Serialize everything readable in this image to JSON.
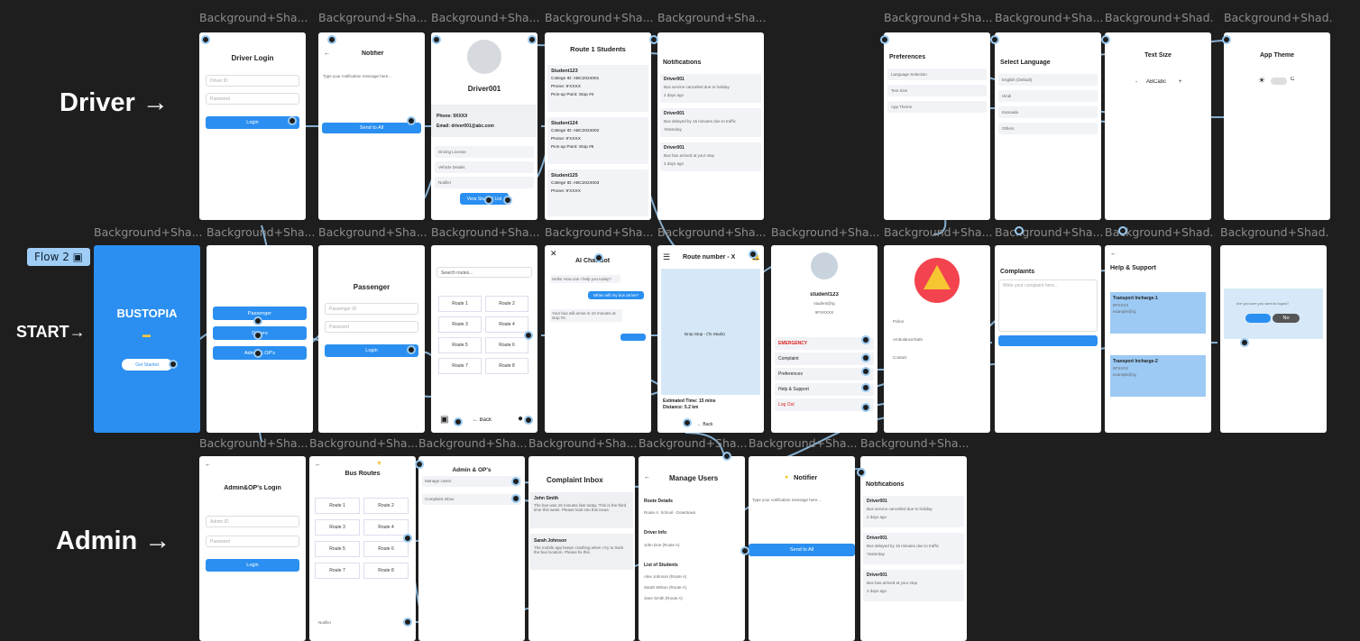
{
  "flow": {
    "label": "Flow 2"
  },
  "rows": {
    "driver": "Driver →",
    "start": "START→",
    "admin": "Admin →"
  },
  "frame_label": {
    "short": "Background+Sha...",
    "long": "Background+Shad..."
  },
  "brand": {
    "name": "BUSTOPIA",
    "cta": "Get Started",
    "color": "#2a8ff0"
  },
  "driver_login": {
    "title": "Driver Login",
    "id_ph": "Driver ID",
    "pw_ph": "Password",
    "button": "Login"
  },
  "driver_notifier": {
    "title": "Notifier",
    "ph": "Type your notification message here...",
    "button": "Send to All"
  },
  "driver_profile": {
    "name": "Driver001",
    "phone": "Phone: 9XXXX",
    "email": "Email: driver001@abc.com",
    "items": [
      "Driving License",
      "Vehicle Details",
      "Notifier"
    ],
    "button": "View Student List"
  },
  "route_students": {
    "title": "Route 1 Students",
    "students": [
      {
        "name": "Student123",
        "college": "College ID: ABC2024001",
        "phone": "Phone: 9'XXXX",
        "pickup": "Pick-up Point: Stop #4"
      },
      {
        "name": "Student124",
        "college": "College ID: ABC2024002",
        "phone": "Phone: 9'XXXX",
        "pickup": "Pick-up Point: Stop #6"
      },
      {
        "name": "Student125",
        "college": "College ID: ABC2024003",
        "phone": "Phone: 9'XXXX",
        "pickup": ""
      }
    ]
  },
  "driver_notifs": {
    "title": "Notifications",
    "items": [
      {
        "from": "Driver001",
        "msg": "Bus service cancelled due to holiday",
        "time": "2 days ago"
      },
      {
        "from": "Driver001",
        "msg": "Bus delayed by 15 minutes due to traffic",
        "time": "Yesterday"
      },
      {
        "from": "Driver001",
        "msg": "Bus has arrived at your stop",
        "time": "2 days ago"
      }
    ]
  },
  "preferences": {
    "title": "Preferences",
    "items": [
      "Language Selection",
      "Text Size",
      "App Theme"
    ]
  },
  "select_language": {
    "title": "Select Language",
    "items": [
      "English (Default)",
      "Hindi",
      "Kannada",
      "Others"
    ]
  },
  "text_size": {
    "title": "Text Size",
    "minus": "-",
    "sample": "ABCabc",
    "plus": "+"
  },
  "app_theme": {
    "title": "App Theme",
    "sun": "☀",
    "moon": "C"
  },
  "passenger_select": {
    "items": [
      "Passenger",
      "Drivers",
      "Admin & OP's"
    ]
  },
  "passenger_login": {
    "title": "Passenger",
    "id_ph": "Passenger ID",
    "pw_ph": "Password",
    "button": "Login"
  },
  "route_search": {
    "ph": "Search routes...",
    "routes": [
      "Route 1",
      "Route 2",
      "Route 3",
      "Route 4",
      "Route 5",
      "Route 6",
      "Route 7",
      "Route 8"
    ],
    "back": "← Back"
  },
  "chat": {
    "title": "AI Chat Bot",
    "m1": "Hello! How can I help you today?",
    "m2": "When will my bus arrive?",
    "m3": "Your bus will arrive in 10 minutes at stop #4."
  },
  "route_map": {
    "title": "Route number - X",
    "stop": "Drop Stop - (To Studs)",
    "eta": "Estimated Time: 15 mins",
    "dist": "Distance: 5.2 km",
    "back": "← Back"
  },
  "student_menu": {
    "name": "student123",
    "email": "student@rg",
    "phone": "9FXXXXX",
    "items": [
      "EMERGENCY",
      "Complaint",
      "Preferences",
      "Help & Support",
      "Log Out"
    ]
  },
  "emergency": {
    "items": [
      "Police",
      "Ambulance/Safe",
      "Contact"
    ]
  },
  "complaints": {
    "title": "Complaints",
    "ph": "Write your complaint here..."
  },
  "help": {
    "title": "Help & Support",
    "c1": "Transport Incharge-1",
    "c1p": "9FXXXX",
    "c1e": "example@rg",
    "c2": "Transport Incharge-2",
    "c2p": "9FXXXX",
    "c2e": "example@rg"
  },
  "logout": {
    "q": "Are you sure you want to logout?",
    "no": "No"
  },
  "admin_login": {
    "title": "Admin&OP's Login",
    "id_ph": "Admin ID",
    "pw_ph": "Password",
    "button": "Login"
  },
  "bus_routes": {
    "title": "Bus Routes",
    "routes": [
      "Route 1",
      "Route 2",
      "Route 3",
      "Route 4",
      "Route 5",
      "Route 6",
      "Route 7",
      "Route 8"
    ],
    "notifier": "Notifier"
  },
  "admin_ops": {
    "title": "Admin & OP's",
    "items": [
      "Manage Users",
      "Complaint Inbox"
    ]
  },
  "complaint_inbox": {
    "title": "Complaint Inbox",
    "n1": "John Smith",
    "t1": "The bus was 15 minutes late today. This is the third time this week. Please look into this issue.",
    "n2": "Sarah Johnson",
    "t2": "The mobile app keeps crashing when I try to track the bus location. Please fix this."
  },
  "manage_users": {
    "title": "Manage Users",
    "route_details": "Route Details",
    "route": "Route A: School - Downtown",
    "driver_info": "Driver Info",
    "driver": "John Doe (Route A)",
    "list_title": "List of Students",
    "students": [
      "Alex Johnson (Route A)",
      "Sarah Wilson (Route A)",
      "Jane Smith (Route A)"
    ]
  },
  "admin_notifier": {
    "title": "Notifier",
    "ph": "Type your notification message here...",
    "button": "Send to All"
  },
  "admin_notifs": {
    "title": "Notifications",
    "items": [
      {
        "from": "Driver001",
        "msg": "Bus service cancelled due to holiday",
        "time": "2 days ago"
      },
      {
        "from": "Driver001",
        "msg": "Bus delayed by 15 minutes due to traffic",
        "time": "Yesterday"
      },
      {
        "from": "Driver001",
        "msg": "Bus has arrived at your stop",
        "time": "2 days ago"
      }
    ]
  }
}
